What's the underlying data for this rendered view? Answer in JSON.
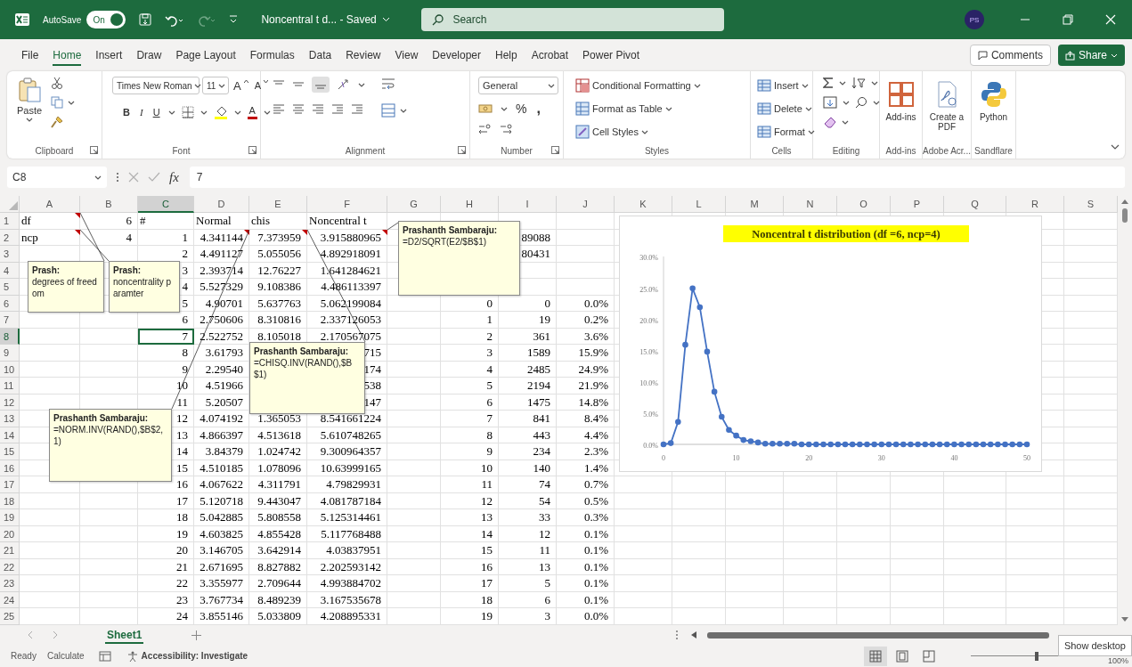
{
  "title_bar": {
    "autosave_label": "AutoSave",
    "autosave": {
      "label": "On",
      "on": true
    },
    "document_title": "Noncentral t d... - Saved",
    "search": {
      "placeholder": "Search"
    },
    "account_initials": "PS"
  },
  "ribbon_tabs": [
    {
      "label": "File",
      "selected": false
    },
    {
      "label": "Home",
      "selected": true
    },
    {
      "label": "Insert",
      "selected": false
    },
    {
      "label": "Draw",
      "selected": false
    },
    {
      "label": "Page Layout",
      "selected": false
    },
    {
      "label": "Formulas",
      "selected": false
    },
    {
      "label": "Data",
      "selected": false
    },
    {
      "label": "Review",
      "selected": false
    },
    {
      "label": "View",
      "selected": false
    },
    {
      "label": "Developer",
      "selected": false
    },
    {
      "label": "Help",
      "selected": false
    },
    {
      "label": "Acrobat",
      "selected": false
    },
    {
      "label": "Power Pivot",
      "selected": false
    }
  ],
  "comments_button": "Comments",
  "share_button": "Share",
  "ribbon_groups": [
    {
      "kind": "clipboard",
      "label": "Clipboard",
      "launcher": true,
      "paste": "Paste"
    },
    {
      "kind": "font",
      "label": "Font",
      "launcher": true,
      "font_name": "Times New Roman",
      "font_size": "11",
      "size_buttons": [
        "A",
        "A"
      ],
      "style_buttons": [
        "B",
        "I",
        "U"
      ],
      "font_color": "A"
    },
    {
      "kind": "alignment",
      "label": "Alignment",
      "launcher": true
    },
    {
      "kind": "number",
      "label": "Number",
      "launcher": true,
      "format": "General",
      "buttons": [
        "%",
        ","
      ]
    },
    {
      "kind": "styles",
      "label": "Styles",
      "launcher": false,
      "commands": [
        "Conditional Formatting",
        "Format as Table",
        "Cell Styles"
      ]
    },
    {
      "kind": "cells",
      "label": "Cells",
      "launcher": false,
      "commands": [
        "Insert",
        "Delete",
        "Format"
      ]
    },
    {
      "kind": "editing",
      "label": "Editing",
      "launcher": false
    },
    {
      "kind": "big",
      "label": "Add-ins",
      "launcher": false,
      "command": "Add-ins"
    },
    {
      "kind": "big",
      "label": "Adobe Acr...",
      "launcher": false,
      "command": "Create a PDF"
    },
    {
      "kind": "big",
      "label": "Sandflare",
      "launcher": false,
      "command": "Python"
    }
  ],
  "formula_bar": {
    "name_box": "C8",
    "function_label": "fx",
    "value": "7"
  },
  "sheet": {
    "columns": [
      {
        "label": "A",
        "selected": false
      },
      {
        "label": "B",
        "selected": false
      },
      {
        "label": "C",
        "selected": true
      },
      {
        "label": "D",
        "selected": false
      },
      {
        "label": "E",
        "selected": false
      },
      {
        "label": "F",
        "selected": false
      },
      {
        "label": "G",
        "selected": false
      },
      {
        "label": "H",
        "selected": false
      },
      {
        "label": "I",
        "selected": false
      },
      {
        "label": "J",
        "selected": false
      },
      {
        "label": "K",
        "selected": false
      },
      {
        "label": "L",
        "selected": false
      },
      {
        "label": "M",
        "selected": false
      },
      {
        "label": "N",
        "selected": false
      },
      {
        "label": "O",
        "selected": false
      },
      {
        "label": "P",
        "selected": false
      },
      {
        "label": "Q",
        "selected": false
      },
      {
        "label": "R",
        "selected": false
      },
      {
        "label": "S",
        "selected": false
      }
    ],
    "rows": [
      {
        "number": "1",
        "selected": false,
        "cells": {
          "col_a": "df",
          "col_b": "6",
          "col_c": "#",
          "col_d": "Normal",
          "col_e": "chis",
          "col_f": "Noncentral t"
        }
      },
      {
        "number": "2",
        "selected": false,
        "cells": {
          "col_a": "ncp",
          "col_b": "4",
          "col_c": "1",
          "col_d": "4.341144",
          "col_e": "7.373959",
          "col_f": "3.915880965",
          "col_i": "89088"
        }
      },
      {
        "number": "3",
        "selected": false,
        "cells": {
          "col_c": "2",
          "col_d": "4.491127",
          "col_e": "5.055056",
          "col_f": "4.892918091",
          "col_i": "80431"
        }
      },
      {
        "number": "4",
        "selected": false,
        "cells": {
          "col_c": "3",
          "col_d": "2.393714",
          "col_e": "12.76227",
          "col_f": "1.641284621"
        }
      },
      {
        "number": "5",
        "selected": false,
        "cells": {
          "col_c": "4",
          "col_d": "5.527329",
          "col_e": "9.108386",
          "col_f": "4.486113397"
        }
      },
      {
        "number": "6",
        "selected": false,
        "cells": {
          "col_c": "5",
          "col_d": "4.90701",
          "col_e": "5.637763",
          "col_f": "5.062199084",
          "col_h": "0",
          "col_i": "0",
          "col_j": "0.0%"
        }
      },
      {
        "number": "7",
        "selected": false,
        "cells": {
          "col_c": "6",
          "col_d": "2.750606",
          "col_e": "8.310816",
          "col_f": "2.337126053",
          "col_h": "1",
          "col_i": "19",
          "col_j": "0.2%"
        }
      },
      {
        "number": "8",
        "selected": true,
        "cells": {
          "col_c": "7",
          "col_d": "2.522752",
          "col_e": "8.105018",
          "col_f": "2.170567075",
          "col_h": "2",
          "col_i": "361",
          "col_j": "3.6%"
        }
      },
      {
        "number": "9",
        "selected": false,
        "cells": {
          "col_c": "8",
          "col_d": "3.61793",
          "col_f": "715",
          "col_h": "3",
          "col_i": "1589",
          "col_j": "15.9%"
        }
      },
      {
        "number": "10",
        "selected": false,
        "cells": {
          "col_c": "9",
          "col_d": "2.29540",
          "col_f": "174",
          "col_h": "4",
          "col_i": "2485",
          "col_j": "24.9%"
        }
      },
      {
        "number": "11",
        "selected": false,
        "cells": {
          "col_c": "10",
          "col_d": "4.51966",
          "col_f": "538",
          "col_h": "5",
          "col_i": "2194",
          "col_j": "21.9%"
        }
      },
      {
        "number": "12",
        "selected": false,
        "cells": {
          "col_c": "11",
          "col_d": "5.20507",
          "col_f": "147",
          "col_h": "6",
          "col_i": "1475",
          "col_j": "14.8%"
        }
      },
      {
        "number": "13",
        "selected": false,
        "cells": {
          "col_c": "12",
          "col_d": "4.074192",
          "col_e": "1.365053",
          "col_f": "8.541661224",
          "col_h": "7",
          "col_i": "841",
          "col_j": "8.4%"
        }
      },
      {
        "number": "14",
        "selected": false,
        "cells": {
          "col_c": "13",
          "col_d": "4.866397",
          "col_e": "4.513618",
          "col_f": "5.610748265",
          "col_h": "8",
          "col_i": "443",
          "col_j": "4.4%"
        }
      },
      {
        "number": "15",
        "selected": false,
        "cells": {
          "col_c": "14",
          "col_d": "3.84379",
          "col_e": "1.024742",
          "col_f": "9.300964357",
          "col_h": "9",
          "col_i": "234",
          "col_j": "2.3%"
        }
      },
      {
        "number": "16",
        "selected": false,
        "cells": {
          "col_c": "15",
          "col_d": "4.510185",
          "col_e": "1.078096",
          "col_f": "10.63999165",
          "col_h": "10",
          "col_i": "140",
          "col_j": "1.4%"
        }
      },
      {
        "number": "17",
        "selected": false,
        "cells": {
          "col_c": "16",
          "col_d": "4.067622",
          "col_e": "4.311791",
          "col_f": "4.79829931",
          "col_h": "11",
          "col_i": "74",
          "col_j": "0.7%"
        }
      },
      {
        "number": "18",
        "selected": false,
        "cells": {
          "col_c": "17",
          "col_d": "5.120718",
          "col_e": "9.443047",
          "col_f": "4.081787184",
          "col_h": "12",
          "col_i": "54",
          "col_j": "0.5%"
        }
      },
      {
        "number": "19",
        "selected": false,
        "cells": {
          "col_c": "18",
          "col_d": "5.042885",
          "col_e": "5.808558",
          "col_f": "5.125314461",
          "col_h": "13",
          "col_i": "33",
          "col_j": "0.3%"
        }
      },
      {
        "number": "20",
        "selected": false,
        "cells": {
          "col_c": "19",
          "col_d": "4.603825",
          "col_e": "4.855428",
          "col_f": "5.117768488",
          "col_h": "14",
          "col_i": "12",
          "col_j": "0.1%"
        }
      },
      {
        "number": "21",
        "selected": false,
        "cells": {
          "col_c": "20",
          "col_d": "3.146705",
          "col_e": "3.642914",
          "col_f": "4.03837951",
          "col_h": "15",
          "col_i": "11",
          "col_j": "0.1%"
        }
      },
      {
        "number": "22",
        "selected": false,
        "cells": {
          "col_c": "21",
          "col_d": "2.671695",
          "col_e": "8.827882",
          "col_f": "2.202593142",
          "col_h": "16",
          "col_i": "13",
          "col_j": "0.1%"
        }
      },
      {
        "number": "23",
        "selected": false,
        "cells": {
          "col_c": "22",
          "col_d": "3.355977",
          "col_e": "2.709644",
          "col_f": "4.993884702",
          "col_h": "17",
          "col_i": "5",
          "col_j": "0.1%"
        }
      },
      {
        "number": "24",
        "selected": false,
        "cells": {
          "col_c": "23",
          "col_d": "3.767734",
          "col_e": "8.489239",
          "col_f": "3.167535678",
          "col_h": "18",
          "col_i": "6",
          "col_j": "0.1%"
        }
      },
      {
        "number": "25",
        "selected": false,
        "cells": {
          "col_c": "24",
          "col_d": "3.855146",
          "col_e": "5.033809",
          "col_f": "4.208895331",
          "col_h": "19",
          "col_i": "3",
          "col_j": "0.0%"
        }
      }
    ],
    "comments": [
      {
        "author": "Prash:",
        "text": "degrees of freedom"
      },
      {
        "author": "Prash:",
        "text": "noncentrality paramter"
      },
      {
        "author": "Prashanth Sambaraju:",
        "text": "=D2/SQRT(E2/$B$1)"
      },
      {
        "author": "Prashanth Sambaraju:",
        "text": "=CHISQ.INV(RAND(),$B$1)"
      },
      {
        "author": "Prashanth Sambaraju:",
        "text": "=NORM.INV(RAND(),$B$2,1)"
      }
    ],
    "chart_data": {
      "type": "line",
      "title": "Noncentral t distribution (df =6, ncp=4)",
      "x": [
        0,
        1,
        2,
        3,
        4,
        5,
        6,
        7,
        8,
        9,
        10,
        11,
        12,
        13,
        14,
        15,
        16,
        17,
        18,
        19,
        20,
        21,
        22,
        23,
        24,
        25,
        26,
        27,
        28,
        29,
        30,
        31,
        32,
        33,
        34,
        35,
        36,
        37,
        38,
        39,
        40,
        41,
        42,
        43,
        44,
        45,
        46,
        47,
        48,
        49,
        50
      ],
      "series": [
        {
          "color": "#4472c4",
          "marker": true,
          "values": [
            0,
            0.002,
            0.036,
            0.159,
            0.249,
            0.219,
            0.148,
            0.084,
            0.044,
            0.023,
            0.014,
            0.007,
            0.005,
            0.003,
            0.001,
            0.001,
            0.001,
            0.001,
            0.001,
            0,
            0,
            0,
            0,
            0,
            0,
            0,
            0,
            0,
            0,
            0,
            0,
            0,
            0,
            0,
            0,
            0,
            0,
            0,
            0,
            0,
            0,
            0,
            0,
            0,
            0,
            0,
            0,
            0,
            0,
            0,
            0
          ]
        }
      ],
      "xlim": [
        0,
        50
      ],
      "ylim": [
        0,
        0.3
      ],
      "xticks": [
        {
          "value": 0,
          "label": "0"
        },
        {
          "value": 10,
          "label": "10"
        },
        {
          "value": 20,
          "label": "20"
        },
        {
          "value": 30,
          "label": "30"
        },
        {
          "value": 40,
          "label": "40"
        },
        {
          "value": 50,
          "label": "50"
        }
      ],
      "yticks": [
        {
          "value": 0,
          "label": "0.0%"
        },
        {
          "value": 0.05,
          "label": "5.0%"
        },
        {
          "value": 0.1,
          "label": "10.0%"
        },
        {
          "value": 0.15,
          "label": "15.0%"
        },
        {
          "value": 0.2,
          "label": "20.0%"
        },
        {
          "value": 0.25,
          "label": "25.0%"
        },
        {
          "value": 0.3,
          "label": "30.0%"
        }
      ]
    }
  },
  "sheet_tabs": [
    {
      "label": "Sheet1",
      "selected": true
    }
  ],
  "status_bar": {
    "ready": "Ready",
    "calculate": "Calculate",
    "accessibility": "Accessibility: Investigate",
    "views": [
      {
        "selected": true
      },
      {
        "selected": false
      },
      {
        "selected": false
      }
    ],
    "zoom_slider": {
      "level": 0.53
    },
    "zoom": "100%",
    "tooltip": "Show desktop"
  }
}
